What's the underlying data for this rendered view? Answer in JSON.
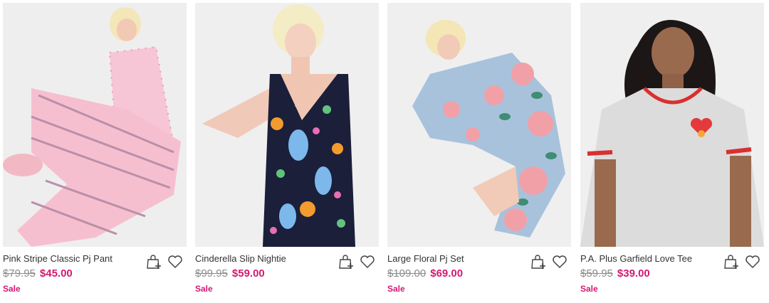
{
  "products": [
    {
      "name": "Pink Stripe Classic Pj Pant",
      "was_price": "$79.95",
      "price": "$45.00",
      "badge": "Sale"
    },
    {
      "name": "Cinderella Slip Nightie",
      "was_price": "$99.95",
      "price": "$59.00",
      "badge": "Sale"
    },
    {
      "name": "Large Floral Pj Set",
      "was_price": "$109.00",
      "price": "$69.00",
      "badge": "Sale"
    },
    {
      "name": "P.A. Plus Garfield Love Tee",
      "was_price": "$59.95",
      "price": "$39.00",
      "badge": "Sale"
    }
  ],
  "icons": {
    "add_to_bag": "bag-plus-icon",
    "wishlist": "heart-icon"
  },
  "colors": {
    "sale": "#d41a72",
    "was_price": "#8b8b8b",
    "image_bg": "#ededed"
  }
}
